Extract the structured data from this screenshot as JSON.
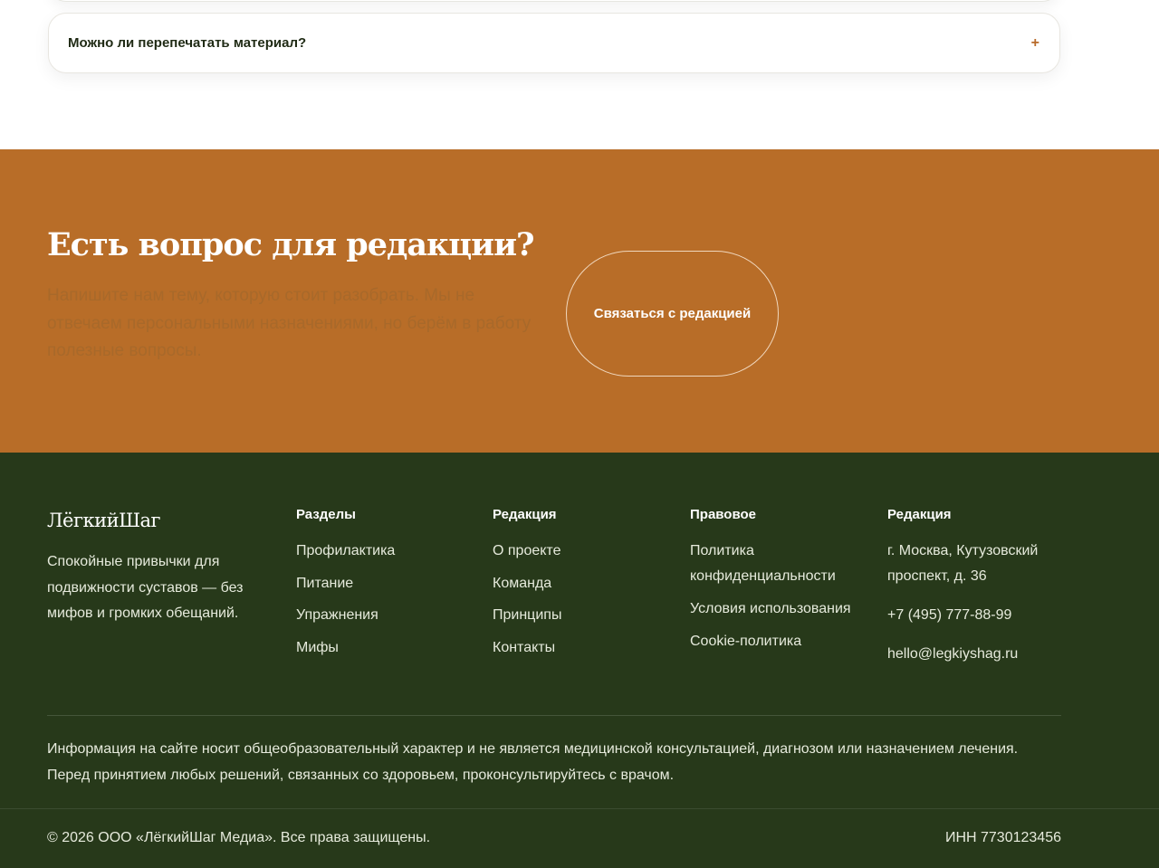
{
  "faq": {
    "question": "Можно ли перепечатать материал?",
    "toggle_icon": "plus-icon"
  },
  "cta": {
    "title": "Есть вопрос для редакции?",
    "text": "Напишите нам тему, которую стоит разобрать. Мы не отвечаем персональными назначениями, но берём в работу полезные вопросы.",
    "button_label": "Связаться с редакцией"
  },
  "footer": {
    "brand": "ЛёгкийШаг",
    "description": "Спокойные привычки для подвижности суставов — без мифов и громких обещаний.",
    "columns": [
      {
        "title": "Разделы",
        "items": [
          "Профилактика",
          "Питание",
          "Упражнения",
          "Мифы"
        ]
      },
      {
        "title": "Редакция",
        "items": [
          "О проекте",
          "Команда",
          "Принципы",
          "Контакты"
        ]
      },
      {
        "title": "Правовое",
        "items": [
          "Политика конфиденциальности",
          "Условия использования",
          "Cookie-политика"
        ]
      },
      {
        "title": "Редакция",
        "items": [
          "г. Москва, Кутузовский проспект, д. 36",
          "+7 (495) 777-88-99",
          "hello@legkiyshag.ru"
        ]
      }
    ],
    "disclaimer": "Информация на сайте носит общеобразовательный характер и не является медицинской консультацией, диагнозом или назначением лечения. Перед принятием любых решений, связанных со здоровьем, проконсультируйтесь с врачом.",
    "copyright": "© 2026 ООО «ЛёгкийШаг Медиа». Все права защищены.",
    "inn": "ИНН 7730123456"
  },
  "colors": {
    "accent": "#b86d28",
    "footer_bg": "#27391a",
    "plus": "#b86a2a"
  }
}
